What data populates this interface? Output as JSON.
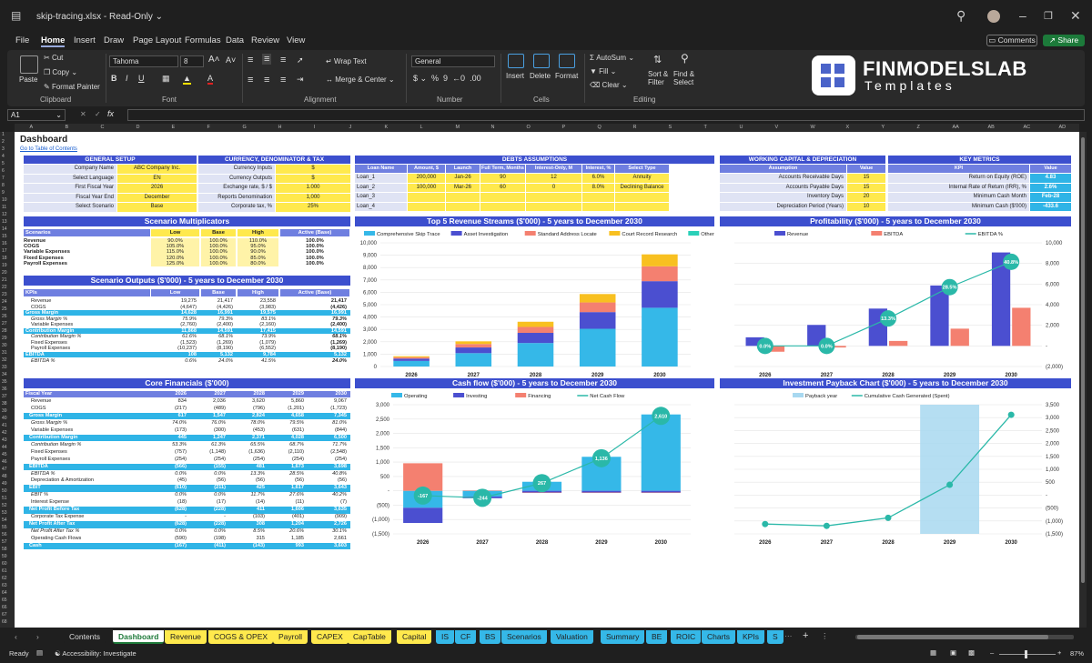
{
  "window": {
    "file_title": "skip-tracing.xlsx",
    "mode": "Read-Only"
  },
  "menu": [
    "File",
    "Home",
    "Insert",
    "Draw",
    "Page Layout",
    "Formulas",
    "Data",
    "Review",
    "View"
  ],
  "menu_active": "Home",
  "buttons": {
    "comments": "Comments",
    "share": "Share"
  },
  "ribbon": {
    "clipboard": {
      "paste": "Paste",
      "cut": "Cut",
      "copy": "Copy",
      "format_painter": "Format Painter",
      "group": "Clipboard"
    },
    "font": {
      "name": "Tahoma",
      "size": "8",
      "group": "Font"
    },
    "alignment": {
      "wrap": "Wrap Text",
      "merge": "Merge & Center",
      "group": "Alignment"
    },
    "number": {
      "format": "General",
      "group": "Number"
    },
    "cells": {
      "insert": "Insert",
      "delete": "Delete",
      "format": "Format",
      "group": "Cells"
    },
    "editing": {
      "autosum": "AutoSum",
      "fill": "Fill",
      "clear": "Clear",
      "sort": "Sort & Filter",
      "find": "Find & Select",
      "group": "Editing"
    }
  },
  "brand": {
    "line1": "FINMODELSLAB",
    "line2": "Templates",
    "accent": "#4a63c9"
  },
  "formula_bar": {
    "cell": "A1",
    "fx": "fx"
  },
  "columns": [
    "A",
    "B",
    "C",
    "D",
    "E",
    "F",
    "G",
    "H",
    "I",
    "J",
    "K",
    "L",
    "M",
    "N",
    "O",
    "P",
    "Q",
    "R",
    "S",
    "T",
    "U",
    "V",
    "W",
    "X",
    "Y",
    "Z",
    "AA",
    "AB",
    "AC",
    "AD"
  ],
  "dashboard": {
    "title": "Dashboard",
    "link": "Go to Table of Contents",
    "general_setup": {
      "header": "GENERAL SETUP",
      "rows": [
        [
          "Company Name",
          "ABC Company Inc."
        ],
        [
          "Select Language",
          "EN"
        ],
        [
          "First Fiscal Year",
          "2026"
        ],
        [
          "Fiscal Year End",
          "December"
        ],
        [
          "Select Scenario",
          "Base"
        ]
      ]
    },
    "currency": {
      "header": "CURRENCY, DENOMINATOR & TAX",
      "rows": [
        [
          "Currency Inputs",
          "$"
        ],
        [
          "Currency Outputs",
          "$"
        ],
        [
          "Exchange rate, $ / $",
          "1.000"
        ],
        [
          "Reports Denomination",
          "1,000"
        ],
        [
          "Corporate tax, %",
          "25%"
        ]
      ]
    },
    "debts": {
      "header": "DEBTS ASSUMPTIONS",
      "cols": [
        "Loan Name",
        "Amount, $",
        "Launch",
        "Full Term, Months",
        "Interest-Only, M",
        "Interest, %",
        "Select Type"
      ],
      "rows": [
        [
          "Loan_1",
          "200,000",
          "Jan-26",
          "90",
          "12",
          "6.0%",
          "Annuity"
        ],
        [
          "Loan_2",
          "100,000",
          "Mar-26",
          "60",
          "0",
          "8.0%",
          "Declining Balance"
        ],
        [
          "Loan_3",
          "",
          "",
          "",
          "",
          "",
          ""
        ],
        [
          "Loan_4",
          "",
          "",
          "",
          "",
          "",
          ""
        ]
      ]
    },
    "working_capital": {
      "header": "WORKING CAPITAL & DEPRECIATION",
      "cols": [
        "Assumption",
        "Value"
      ],
      "rows": [
        [
          "Accounts Receivable Days",
          "15"
        ],
        [
          "Accounts Payable Days",
          "15"
        ],
        [
          "Inventory Days",
          "20"
        ],
        [
          "Depreciation Period (Years)",
          "10"
        ]
      ]
    },
    "key_metrics": {
      "header": "KEY METRICS",
      "cols": [
        "KPI",
        "Value"
      ],
      "rows": [
        [
          "Return on Equity (ROE)",
          "4.83"
        ],
        [
          "Internal Rate of Return (IRR), %",
          "2.6%"
        ],
        [
          "Minimum Cash Month",
          "Feb-28"
        ],
        [
          "Minimum Cash ($'000)",
          "-433.6"
        ]
      ]
    },
    "scenario_multipliers": {
      "header": "Scenario Multiplicators",
      "cols": [
        "Scenarios",
        "Low",
        "Base",
        "High",
        "Active (Base)"
      ],
      "rows": [
        [
          "Revenue",
          "90.0%",
          "100.0%",
          "110.0%",
          "100.0%"
        ],
        [
          "COGS",
          "105.0%",
          "100.0%",
          "95.0%",
          "100.0%"
        ],
        [
          "Variable Expenses",
          "115.0%",
          "100.0%",
          "90.0%",
          "100.0%"
        ],
        [
          "Fixed Expenses",
          "120.0%",
          "100.0%",
          "85.0%",
          "100.0%"
        ],
        [
          "Payroll Expenses",
          "125.0%",
          "100.0%",
          "80.0%",
          "100.0%"
        ]
      ]
    },
    "scenario_outputs": {
      "header": "Scenario Outputs ($'000) - 5 years to December 2030",
      "cols": [
        "KPIs",
        "Low",
        "Base",
        "High",
        "Active (Base)"
      ],
      "rows": [
        [
          "Revenue",
          "19,275",
          "21,417",
          "23,558",
          "21,417",
          ""
        ],
        [
          "COGS",
          "(4,647)",
          "(4,426)",
          "(3,983)",
          "(4,426)",
          ""
        ],
        [
          "Gross Margin",
          "14,628",
          "16,991",
          "19,575",
          "16,991",
          "hl"
        ],
        [
          "Gross Margin %",
          "75.9%",
          "79.3%",
          "83.1%",
          "79.3%",
          "it"
        ],
        [
          "Variable Expenses",
          "(2,760)",
          "(2,400)",
          "(2,160)",
          "(2,400)",
          ""
        ],
        [
          "Contribution Margin",
          "11,868",
          "14,591",
          "17,415",
          "14,591",
          "hl"
        ],
        [
          "Contribution Margin %",
          "61.6%",
          "68.1%",
          "73.9%",
          "68.1%",
          "it"
        ],
        [
          "Fixed Expenses",
          "(1,523)",
          "(1,269)",
          "(1,079)",
          "(1,269)",
          ""
        ],
        [
          "Payroll Expenses",
          "(10,237)",
          "(8,190)",
          "(6,552)",
          "(8,190)",
          ""
        ],
        [
          "EBITDA",
          "108",
          "5,132",
          "9,784",
          "5,132",
          "hl"
        ],
        [
          "EBITDA %",
          "0.6%",
          "24.0%",
          "41.5%",
          "24.0%",
          "it"
        ]
      ]
    },
    "core_financials": {
      "header": "Core Financials ($'000)",
      "cols": [
        "Fiscal Year",
        "2026",
        "2027",
        "2028",
        "2029",
        "2030"
      ],
      "rows": [
        [
          "Revenue",
          "834",
          "2,036",
          "3,620",
          "5,860",
          "9,067",
          ""
        ],
        [
          "COGS",
          "(217)",
          "(489)",
          "(796)",
          "(1,201)",
          "(1,723)",
          ""
        ],
        [
          "Gross Margin",
          "617",
          "1,547",
          "2,824",
          "4,658",
          "7,345",
          "hl"
        ],
        [
          "Gross Margin %",
          "74.0%",
          "76.0%",
          "78.0%",
          "79.5%",
          "81.0%",
          "it"
        ],
        [
          "Variable Expenses",
          "(173)",
          "(300)",
          "(453)",
          "(631)",
          "(844)",
          ""
        ],
        [
          "Contribution Margin",
          "445",
          "1,247",
          "2,371",
          "4,028",
          "6,500",
          "hl"
        ],
        [
          "Contribution Margin %",
          "53.3%",
          "61.3%",
          "65.5%",
          "68.7%",
          "71.7%",
          "it"
        ],
        [
          "Fixed Expenses",
          "(757)",
          "(1,148)",
          "(1,636)",
          "(2,110)",
          "(2,548)",
          ""
        ],
        [
          "Payroll Expenses",
          "(254)",
          "(254)",
          "(254)",
          "(254)",
          "(254)",
          ""
        ],
        [
          "EBITDA",
          "(566)",
          "(155)",
          "481",
          "1,673",
          "3,698",
          "hl"
        ],
        [
          "EBITDA %",
          "0.0%",
          "0.0%",
          "13.3%",
          "28.5%",
          "40.8%",
          "it"
        ],
        [
          "Depreciation & Amortization",
          "(45)",
          "(56)",
          "(56)",
          "(56)",
          "(56)",
          ""
        ],
        [
          "EBIT",
          "(610)",
          "(211)",
          "425",
          "1,617",
          "3,643",
          "hl"
        ],
        [
          "EBIT %",
          "0.0%",
          "0.0%",
          "11.7%",
          "27.6%",
          "40.2%",
          "it"
        ],
        [
          "Interest Expense",
          "(18)",
          "(17)",
          "(14)",
          "(11)",
          "(7)",
          ""
        ],
        [
          "Net Profit Before Tax",
          "(628)",
          "(228)",
          "411",
          "1,606",
          "3,635",
          "hl"
        ],
        [
          "Corporate Tax Expense",
          "-",
          "-",
          "(103)",
          "(401)",
          "(909)",
          ""
        ],
        [
          "Net Profit After Tax",
          "(628)",
          "(228)",
          "308",
          "1,204",
          "2,726",
          "hl"
        ],
        [
          "Net Profit After Tax %",
          "0.0%",
          "0.0%",
          "8.5%",
          "20.6%",
          "30.1%",
          "it"
        ],
        [
          "Operating Cash Flows",
          "(590)",
          "(198)",
          "315",
          "1,185",
          "2,661",
          ""
        ],
        [
          "Cash",
          "(167)",
          "(411)",
          "(143)",
          "993",
          "3,603",
          "hl"
        ]
      ]
    }
  },
  "chart_data": [
    {
      "type": "bar",
      "title": "Top 5 Revenue Streams ($'000) - 5 years to December 2030",
      "categories": [
        "2026",
        "2027",
        "2028",
        "2029",
        "2030"
      ],
      "stacked": true,
      "ylim": [
        0,
        10000
      ],
      "yticks": [
        "0",
        "1,000",
        "2,000",
        "3,000",
        "4,000",
        "5,000",
        "6,000",
        "7,000",
        "8,000",
        "9,000",
        "10,000"
      ],
      "legend": "top",
      "series": [
        {
          "name": "Comprehensive Skip Trace",
          "color": "#35b8e8",
          "values": [
            450,
            1080,
            1900,
            3050,
            4750
          ]
        },
        {
          "name": "Asset Investigation",
          "color": "#4b4fd0",
          "values": [
            190,
            460,
            820,
            1350,
            2150
          ]
        },
        {
          "name": "Standard Address Locate",
          "color": "#f48070",
          "values": [
            110,
            280,
            480,
            780,
            1200
          ]
        },
        {
          "name": "Court Record Research",
          "color": "#f8c020",
          "values": [
            84,
            216,
            420,
            680,
            967
          ]
        },
        {
          "name": "Other Revenue",
          "color": "#2ad0b8",
          "values": [
            0,
            0,
            0,
            0,
            0
          ]
        }
      ]
    },
    {
      "type": "bar",
      "title": "Profitability ($'000) - 5 years to December 2030",
      "categories": [
        "2026",
        "2027",
        "2028",
        "2029",
        "2030"
      ],
      "ylim": [
        -2000,
        10000
      ],
      "yticks": [
        "(2,000)",
        "-",
        "2,000",
        "4,000",
        "6,000",
        "8,000",
        "10,000"
      ],
      "legend": "top",
      "series": [
        {
          "name": "Revenue",
          "color": "#4b4fd0",
          "values": [
            834,
            2036,
            3620,
            5860,
            9067
          ]
        },
        {
          "name": "EBITDA",
          "color": "#f48070",
          "values": [
            -566,
            -155,
            481,
            1673,
            3698
          ]
        },
        {
          "name": "EBITDA %",
          "color": "#2ab8a8",
          "type": "line",
          "values": [
            0.0,
            0.0,
            13.3,
            28.5,
            40.8
          ],
          "labels": [
            "0.0%",
            "0.0%",
            "13.3%",
            "28.5%",
            "40.8%"
          ]
        }
      ]
    },
    {
      "type": "bar",
      "title": "Cash flow ($'000) - 5 years to December 2030",
      "categories": [
        "2026",
        "2027",
        "2028",
        "2029",
        "2030"
      ],
      "ylim": [
        -1500,
        3000
      ],
      "yticks": [
        "(1,500)",
        "(1,000)",
        "(500)",
        "-",
        "500",
        "1,000",
        "1,500",
        "2,000",
        "2,500",
        "3,000"
      ],
      "legend": "top",
      "series": [
        {
          "name": "Operating",
          "color": "#35b8e8",
          "values": [
            -590,
            -198,
            315,
            1185,
            2661
          ]
        },
        {
          "name": "Investing",
          "color": "#4b4fd0",
          "values": [
            -530,
            -60,
            -60,
            -60,
            -60
          ]
        },
        {
          "name": "Financing",
          "color": "#f48070",
          "values": [
            960,
            15,
            -15,
            -15,
            -15
          ]
        },
        {
          "name": "Net Cash Flow",
          "color": "#2ab8a8",
          "type": "line",
          "values": [
            -167,
            -244,
            267,
            1136,
            2610
          ],
          "labels": [
            "-167",
            "-244",
            "267",
            "1,136",
            "2,610"
          ]
        }
      ]
    },
    {
      "type": "bar",
      "title": "Investment Payback Chart ($'000) - 5 years to December 2030",
      "categories": [
        "2026",
        "2027",
        "2028",
        "2029",
        "2030"
      ],
      "ylim": [
        -1500,
        3500
      ],
      "yticks": [
        "(1,500)",
        "(1,000)",
        "(500)",
        "-",
        "500",
        "1,000",
        "1,500",
        "2,000",
        "2,500",
        "3,000",
        "3,500"
      ],
      "legend": "top",
      "series": [
        {
          "name": "Payback year",
          "color": "#a8d8f0",
          "values": [
            0,
            0,
            0,
            1,
            0
          ]
        },
        {
          "name": "Cumulative Cash Generated (Spent)",
          "color": "#2ab8a8",
          "type": "line",
          "values": [
            -1120,
            -1190,
            -880,
            400,
            3110
          ]
        }
      ]
    }
  ],
  "sheet_tabs": [
    {
      "label": "Contents",
      "color": "#1f1f1f",
      "text": "#ddd"
    },
    {
      "label": "Dashboard",
      "color": "#ffffff",
      "text": "#1e7a3a",
      "active": true
    },
    {
      "label": "Revenue",
      "color": "#ffe94d"
    },
    {
      "label": "COGS & OPEX",
      "color": "#ffe94d"
    },
    {
      "label": "Payroll",
      "color": "#ffe94d"
    },
    {
      "label": "CAPEX",
      "color": "#ffe94d"
    },
    {
      "label": "CapTable",
      "color": "#ffe94d"
    },
    {
      "label": "Capital",
      "color": "#ffe94d"
    },
    {
      "label": "IS",
      "color": "#35b8e8"
    },
    {
      "label": "CF",
      "color": "#35b8e8"
    },
    {
      "label": "BS",
      "color": "#35b8e8"
    },
    {
      "label": "Scenarios",
      "color": "#35b8e8"
    },
    {
      "label": "Valuation",
      "color": "#35b8e8"
    },
    {
      "label": "Summary",
      "color": "#35b8e8"
    },
    {
      "label": "BE",
      "color": "#35b8e8"
    },
    {
      "label": "ROIC",
      "color": "#35b8e8"
    },
    {
      "label": "Charts",
      "color": "#35b8e8"
    },
    {
      "label": "KPIs",
      "color": "#35b8e8"
    },
    {
      "label": "S",
      "color": "#35b8e8"
    }
  ],
  "status": {
    "ready": "Ready",
    "accessibility": "Accessibility: Investigate",
    "zoom": "87%"
  }
}
